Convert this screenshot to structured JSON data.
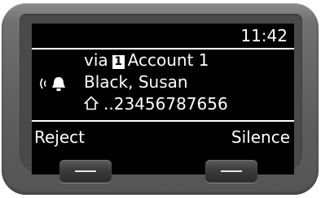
{
  "screen": {
    "clock": "11:42",
    "via_prefix": "via",
    "account_badge": "1",
    "account_name": "Account 1",
    "caller_name": "Black, Susan",
    "caller_number": "..23456787656",
    "ring_icon": "ringing-bell-icon",
    "number_type_icon": "home-icon"
  },
  "softkeys": {
    "left_label": "Reject",
    "right_label": "Silence"
  },
  "colors": {
    "screen_background": "#000000",
    "screen_text": "#ffffff",
    "device_body": "#6a6a6a"
  }
}
